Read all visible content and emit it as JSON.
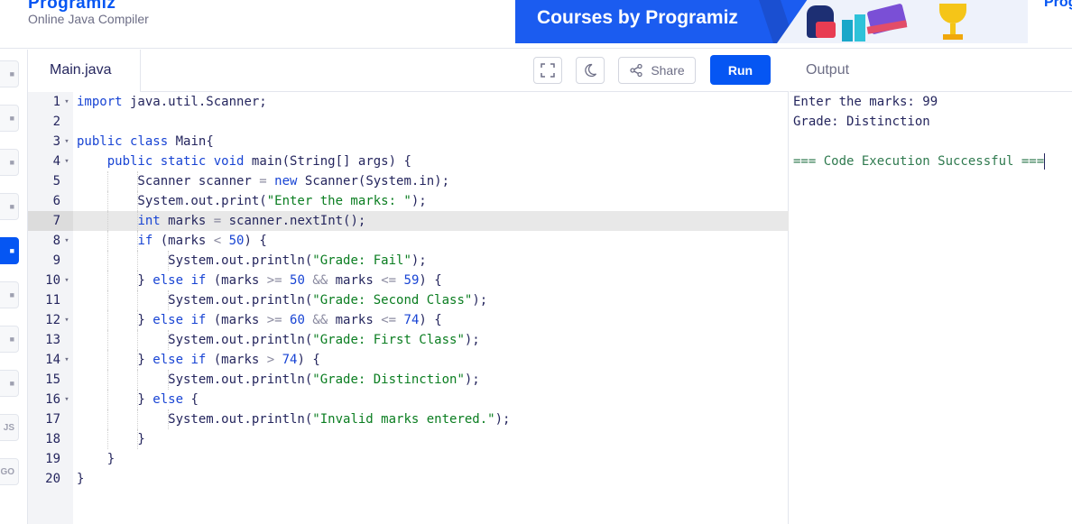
{
  "header": {
    "brand": "Programiz",
    "subtitle": "Online Java Compiler",
    "banner_text": "Courses by Programiz",
    "brand_right": "Prog"
  },
  "colors": {
    "accent": "#0556f3",
    "string": "#0a7d20",
    "keyword": "#1844d4",
    "number": "#1844d4",
    "success": "#2f7a4f"
  },
  "sidebar": {
    "items": [
      {
        "icon": "python-icon",
        "label": ""
      },
      {
        "icon": "r-icon",
        "label": ""
      },
      {
        "icon": "sql-icon",
        "label": ""
      },
      {
        "icon": "html-icon",
        "label": ""
      },
      {
        "icon": "java-icon",
        "label": ""
      },
      {
        "icon": "c-icon",
        "label": ""
      },
      {
        "icon": "cpp-icon",
        "label": ""
      },
      {
        "icon": "csharp-icon",
        "label": ""
      },
      {
        "icon": "javascript-icon",
        "label": "JS"
      },
      {
        "icon": "go-icon",
        "label": "GO"
      }
    ],
    "active_index": 4
  },
  "editor": {
    "file_tab": "Main.java",
    "share_label": "Share",
    "run_label": "Run",
    "active_line": 7,
    "lines": [
      {
        "n": "1",
        "fold": true,
        "text": "import java.util.Scanner;"
      },
      {
        "n": "2",
        "fold": false,
        "text": ""
      },
      {
        "n": "3",
        "fold": true,
        "text": "public class Main{"
      },
      {
        "n": "4",
        "fold": true,
        "text": "    public static void main(String[] args) {"
      },
      {
        "n": "5",
        "fold": false,
        "text": "        Scanner scanner = new Scanner(System.in);"
      },
      {
        "n": "6",
        "fold": false,
        "text": "        System.out.print(\"Enter the marks: \");"
      },
      {
        "n": "7",
        "fold": false,
        "text": "        int marks = scanner.nextInt();"
      },
      {
        "n": "8",
        "fold": true,
        "text": "        if (marks < 50) {"
      },
      {
        "n": "9",
        "fold": false,
        "text": "            System.out.println(\"Grade: Fail\");"
      },
      {
        "n": "10",
        "fold": true,
        "text": "        } else if (marks >= 50 && marks <= 59) {"
      },
      {
        "n": "11",
        "fold": false,
        "text": "            System.out.println(\"Grade: Second Class\");"
      },
      {
        "n": "12",
        "fold": true,
        "text": "        } else if (marks >= 60 && marks <= 74) {"
      },
      {
        "n": "13",
        "fold": false,
        "text": "            System.out.println(\"Grade: First Class\");"
      },
      {
        "n": "14",
        "fold": true,
        "text": "        } else if (marks > 74) {"
      },
      {
        "n": "15",
        "fold": false,
        "text": "            System.out.println(\"Grade: Distinction\");"
      },
      {
        "n": "16",
        "fold": true,
        "text": "        } else {"
      },
      {
        "n": "17",
        "fold": false,
        "text": "            System.out.println(\"Invalid marks entered.\");"
      },
      {
        "n": "18",
        "fold": false,
        "text": "        }"
      },
      {
        "n": "19",
        "fold": false,
        "text": "    }"
      },
      {
        "n": "20",
        "fold": false,
        "text": "}"
      }
    ]
  },
  "output": {
    "title": "Output",
    "lines": [
      "Enter the marks: 99",
      "Grade: Distinction",
      "",
      "=== Code Execution Successful ==="
    ]
  }
}
